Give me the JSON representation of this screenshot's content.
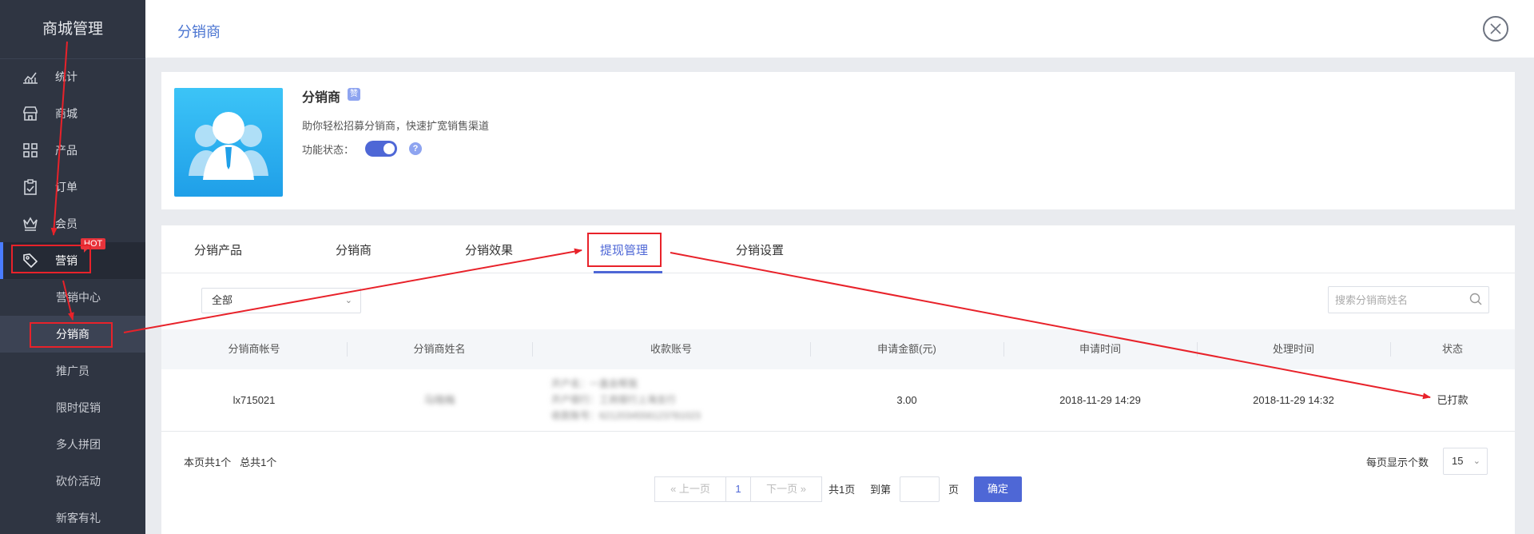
{
  "sidebar": {
    "title": "商城管理",
    "items": [
      {
        "label": "统计",
        "icon": "chart-icon"
      },
      {
        "label": "商城",
        "icon": "store-icon"
      },
      {
        "label": "产品",
        "icon": "grid-icon"
      },
      {
        "label": "订单",
        "icon": "clipboard-icon"
      },
      {
        "label": "会员",
        "icon": "crown-icon"
      },
      {
        "label": "营销",
        "icon": "tag-icon",
        "badge": "HOT"
      }
    ],
    "subitems": [
      "营销中心",
      "分销商",
      "推广员",
      "限时促销",
      "多人拼团",
      "砍价活动",
      "新客有礼"
    ]
  },
  "header": {
    "title": "分销商"
  },
  "info": {
    "name": "分销商",
    "badge": "赞",
    "description": "助你轻松招募分销商，快速扩宽销售渠道",
    "status_label": "功能状态：",
    "status_on": true,
    "help": "?"
  },
  "tabs": [
    "分销产品",
    "分销商",
    "分销效果",
    "提现管理",
    "分销设置"
  ],
  "active_tab": "提现管理",
  "filter": {
    "selected": "全部"
  },
  "search": {
    "placeholder": "搜索分销商姓名"
  },
  "table": {
    "columns": [
      "分销商帐号",
      "分销商姓名",
      "收款账号",
      "申请金额(元)",
      "申请时间",
      "处理时间",
      "状态"
    ],
    "rows": [
      {
        "account": "lx715021",
        "name": "马晓梅",
        "payee": [
          "开户名：一直会帮我",
          "开户银行：工商银行上海支行",
          "收款账号：6212034556123781023"
        ],
        "amount": "3.00",
        "apply_time": "2018-11-29 14:29",
        "process_time": "2018-11-29 14:32",
        "status": "已打款"
      }
    ]
  },
  "footer": {
    "page_info": "本页共1个   总共1个",
    "per_page_label": "每页显示个数",
    "per_page": "15",
    "prev": "上一页",
    "current_page": "1",
    "next": "下一页",
    "total_pages": "共1页",
    "goto_label": "到第",
    "page_unit": "页",
    "confirm": "确定"
  },
  "colors": {
    "sidebar_bg": "#2f3542",
    "accent": "#4e67d6",
    "annotation": "#e8222a"
  }
}
